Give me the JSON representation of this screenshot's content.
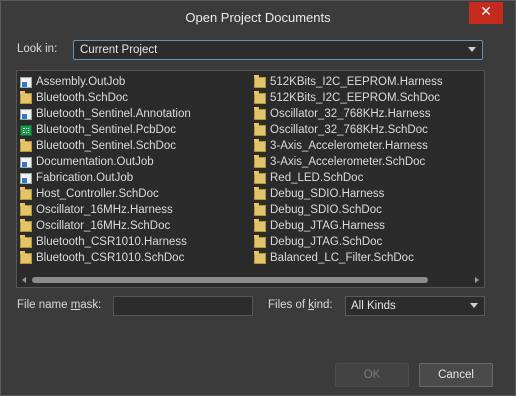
{
  "window": {
    "title": "Open Project Documents"
  },
  "look_in": {
    "label": "Look in:",
    "value": "Current Project"
  },
  "files": {
    "column1": [
      {
        "name": "Assembly.OutJob",
        "icon": "outjob-icon"
      },
      {
        "name": "Bluetooth.SchDoc",
        "icon": "schdoc-icon"
      },
      {
        "name": "Bluetooth_Sentinel.Annotation",
        "icon": "document-icon"
      },
      {
        "name": "Bluetooth_Sentinel.PcbDoc",
        "icon": "pcbdoc-icon"
      },
      {
        "name": "Bluetooth_Sentinel.SchDoc",
        "icon": "schdoc-icon"
      },
      {
        "name": "Documentation.OutJob",
        "icon": "outjob-icon"
      },
      {
        "name": "Fabrication.OutJob",
        "icon": "outjob-icon"
      },
      {
        "name": "Host_Controller.SchDoc",
        "icon": "schdoc-icon"
      },
      {
        "name": "Oscillator_16MHz.Harness",
        "icon": "harness-icon"
      },
      {
        "name": "Oscillator_16MHz.SchDoc",
        "icon": "schdoc-icon"
      },
      {
        "name": "Bluetooth_CSR1010.Harness",
        "icon": "harness-icon"
      },
      {
        "name": "Bluetooth_CSR1010.SchDoc",
        "icon": "schdoc-icon"
      }
    ],
    "column2": [
      {
        "name": "512KBits_I2C_EEPROM.Harness",
        "icon": "harness-icon"
      },
      {
        "name": "512KBits_I2C_EEPROM.SchDoc",
        "icon": "schdoc-icon"
      },
      {
        "name": "Oscillator_32_768KHz.Harness",
        "icon": "harness-icon"
      },
      {
        "name": "Oscillator_32_768KHz.SchDoc",
        "icon": "schdoc-icon"
      },
      {
        "name": "3-Axis_Accelerometer.Harness",
        "icon": "harness-icon"
      },
      {
        "name": "3-Axis_Accelerometer.SchDoc",
        "icon": "schdoc-icon"
      },
      {
        "name": "Red_LED.SchDoc",
        "icon": "schdoc-icon"
      },
      {
        "name": "Debug_SDIO.Harness",
        "icon": "harness-icon"
      },
      {
        "name": "Debug_SDIO.SchDoc",
        "icon": "schdoc-icon"
      },
      {
        "name": "Debug_JTAG.Harness",
        "icon": "harness-icon"
      },
      {
        "name": "Debug_JTAG.SchDoc",
        "icon": "schdoc-icon"
      },
      {
        "name": "Balanced_LC_Filter.SchDoc",
        "icon": "schdoc-icon"
      }
    ]
  },
  "file_name_mask": {
    "label_pre": "File name ",
    "label_u": "m",
    "label_post": "ask:",
    "value": ""
  },
  "files_of_kind": {
    "label_pre": "Files of ",
    "label_u": "k",
    "label_post": "ind:",
    "value": "All Kinds"
  },
  "buttons": {
    "ok": "OK",
    "cancel": "Cancel"
  },
  "colors": {
    "close": "#c42b1c",
    "dialog_bg": "#3b3b3b",
    "list_bg": "#2b2b2b",
    "focus_border": "#6a8fb5"
  }
}
